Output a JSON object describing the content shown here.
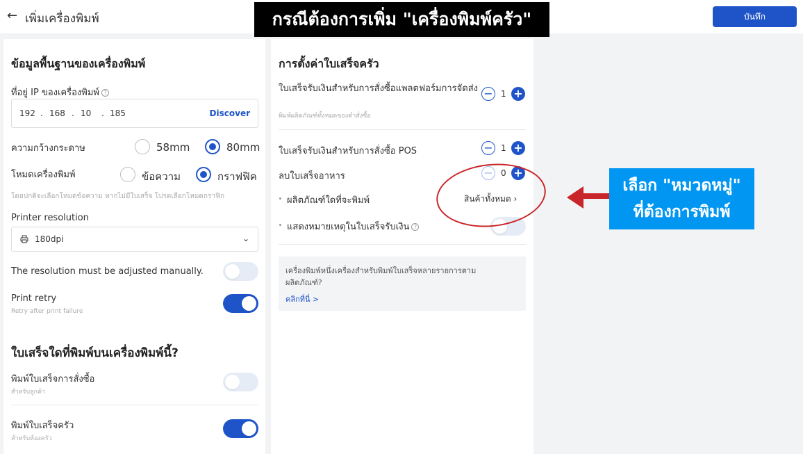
{
  "header": {
    "back_icon": "←",
    "title": "เพิ่มเครื่องพิมพ์",
    "save_label": "บันทึก"
  },
  "overlay": {
    "banner_text": "กรณีต้องการเพิ่ม \"เครื่องพิมพ์ครัว\"",
    "callout_line1": "เลือก \"หมวดหมู่\"",
    "callout_line2": "ที่ต้องการพิมพ์",
    "accent_color": "#c8262a",
    "callout_color": "#0096f2"
  },
  "basic_info": {
    "heading": "ข้อมูลพื้นฐานของเครื่องพิมพ์",
    "ip_label": "ที่อยู่ IP ของเครื่องพิมพ์",
    "ip_segments": [
      "192",
      "168",
      "10",
      "185"
    ],
    "discover_label": "Discover",
    "paper_width_label": "ความกว้างกระดาษ",
    "paper_options": [
      "58mm",
      "80mm"
    ],
    "paper_selected": "80mm",
    "printer_mode_label": "โหมดเครื่องพิมพ์",
    "mode_options": [
      "ข้อความ",
      "กราฟฟิค"
    ],
    "mode_selected": "กราฟฟิค",
    "mode_hint": "โดยปกติจะเลือกโหมดข้อความ หากไม่มีใบเสร็จ โปรดเลือกโหมดกราฟิก",
    "resolution_label": "Printer resolution",
    "resolution_value": "180dpi",
    "manual_resolution_label": "The resolution must be adjusted manually.",
    "manual_resolution_on": false,
    "print_retry_label": "Print retry",
    "print_retry_sub": "Retry after print failure",
    "print_retry_on": true
  },
  "receipt_types": {
    "heading": "ใบเสร็จใดที่พิมพ์บนเครื่องพิมพ์นี้?",
    "order_receipt_label": "พิมพ์ใบเสร็จการสั่งซื้อ",
    "order_receipt_sub": "สำหรับลูกค้า",
    "order_receipt_on": false,
    "kitchen_receipt_label": "พิมพ์ใบเสร็จครัว",
    "kitchen_receipt_sub": "สำหรับห้องครัว",
    "kitchen_receipt_on": true
  },
  "kitchen_settings": {
    "heading": "การตั้งค่าใบเสร็จครัว",
    "platform_label": "ใบเสร็จรับเงินสำหรับการสั่งซื้อแพลตฟอร์มการจัดส่ง",
    "platform_sub": "พิมพ์ผลิตภัณฑ์ทั้งหมดของคำสั่งซื้อ",
    "platform_count": "1",
    "pos_label": "ใบเสร็จรับเงินสำหรับการสั่งซื้อ POS",
    "pos_count": "1",
    "delete_label": "ลบใบเสร็จอาหาร",
    "delete_count": "0",
    "products_label": "ผลิตภัณฑ์ใดที่จะพิมพ์",
    "products_value": "สินค้าทั้งหมด",
    "show_note_label": "แสดงหมายเหตุในใบเสร็จรับเงิน",
    "show_note_on": false,
    "info_text": "เครื่องพิมพ์หนึ่งเครื่องสำหรับพิมพ์ใบเสร็จหลายรายการตามผลิตภัณฑ์?",
    "info_link": "คลิกที่นี่ >"
  }
}
